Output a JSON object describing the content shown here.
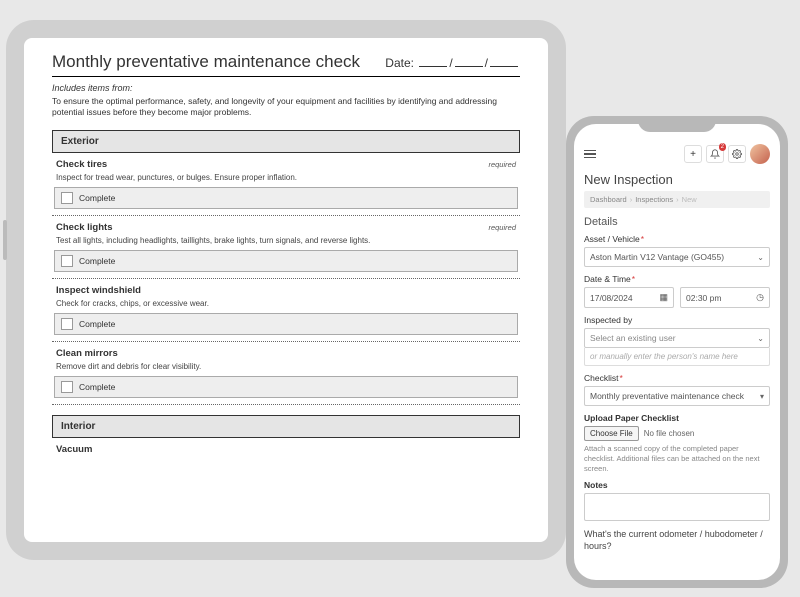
{
  "tablet": {
    "title": "Monthly preventative maintenance check",
    "date_label": "Date:",
    "includes_label": "Includes items from:",
    "intro": "To ensure the optimal performance, safety, and longevity of your equipment and facilities by identifying and addressing potential issues before they become major problems.",
    "complete_label": "Complete",
    "required_label": "required",
    "sections": [
      {
        "header": "Exterior",
        "items": [
          {
            "title": "Check tires",
            "desc": "Inspect for tread wear, punctures, or bulges. Ensure proper inflation.",
            "required": true
          },
          {
            "title": "Check lights",
            "desc": "Test all lights, including headlights, taillights, brake lights, turn signals, and reverse lights.",
            "required": true
          },
          {
            "title": "Inspect windshield",
            "desc": "Check for cracks, chips, or excessive wear.",
            "required": false
          },
          {
            "title": "Clean mirrors",
            "desc": "Remove dirt and debris for clear visibility.",
            "required": false
          }
        ]
      },
      {
        "header": "Interior",
        "items": [
          {
            "title": "Vacuum",
            "desc": "",
            "required": false
          }
        ]
      }
    ]
  },
  "phone": {
    "notification_count": "2",
    "page_title": "New Inspection",
    "breadcrumb": {
      "a": "Dashboard",
      "b": "Inspections",
      "c": "New"
    },
    "details_label": "Details",
    "asset_label": "Asset / Vehicle",
    "asset_value": "Aston Martin V12 Vantage (GO455)",
    "datetime_label": "Date & Time",
    "date_value": "17/08/2024",
    "time_value": "02:30 pm",
    "inspected_label": "Inspected by",
    "inspected_placeholder": "Select an existing user",
    "inspected_manual": "or manually enter the person's name here",
    "checklist_label": "Checklist",
    "checklist_value": "Monthly preventative maintenance check",
    "upload_label": "Upload Paper Checklist",
    "choose_file": "Choose File",
    "no_file": "No file chosen",
    "upload_hint": "Attach a scanned copy of the completed paper checklist. Additional files can be attached on the next screen.",
    "notes_label": "Notes",
    "question": "What's the current odometer / hubodometer / hours?"
  }
}
